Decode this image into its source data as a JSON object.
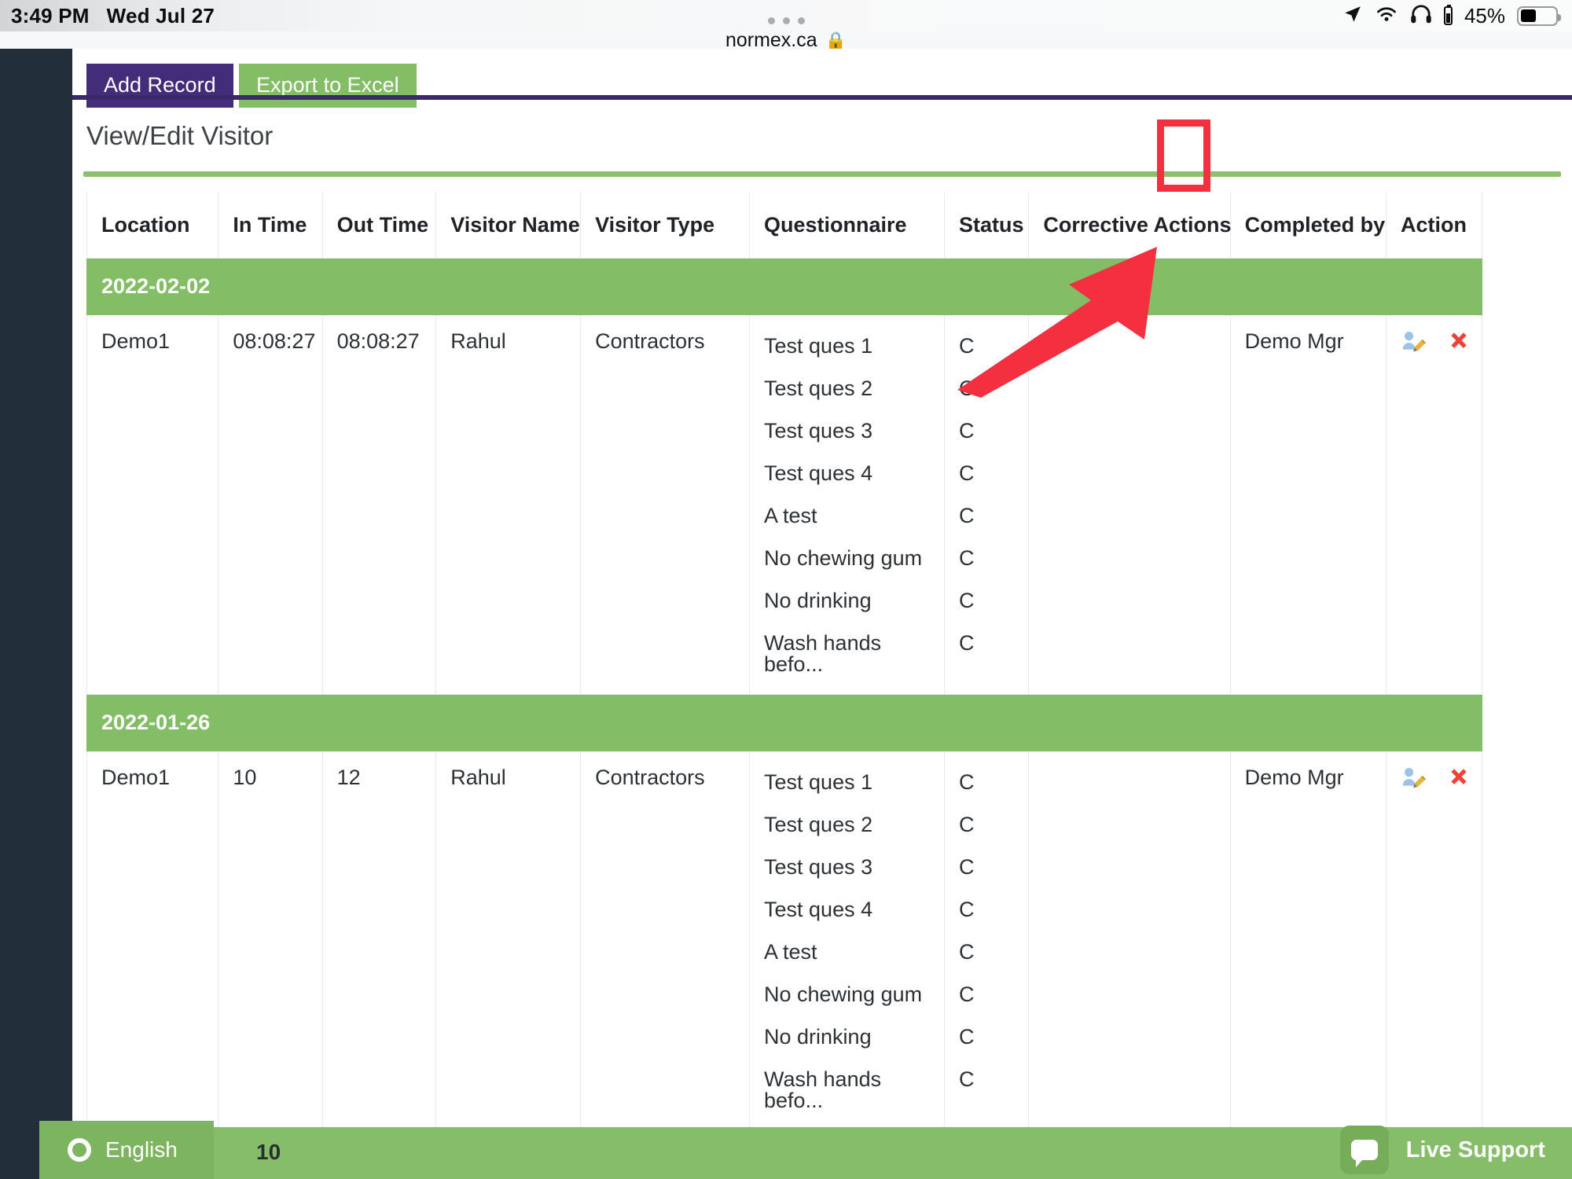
{
  "statusbar": {
    "time": "3:49 PM",
    "date": "Wed Jul 27",
    "battery_percent": "45%",
    "icons": [
      "location-arrow-icon",
      "wifi-icon",
      "headphones-icon",
      "headphone-battery-icon",
      "battery-icon"
    ]
  },
  "browser": {
    "url": "normex.ca",
    "lock": "🔒",
    "tab_dots": 3
  },
  "toolbar": {
    "add_record_label": "Add Record",
    "export_excel_label": "Export to Excel"
  },
  "page": {
    "title": "View/Edit Visitor"
  },
  "table": {
    "columns": [
      "Location",
      "In Time",
      "Out Time",
      "Visitor Name",
      "Visitor Type",
      "Questionnaire",
      "Status",
      "Corrective Actions",
      "Completed by",
      "Action"
    ],
    "groups": [
      {
        "date": "2022-02-02",
        "rows": [
          {
            "location": "Demo1",
            "in_time": "08:08:27",
            "out_time": "08:08:27",
            "visitor_name": "Rahul",
            "visitor_type": "Contractors",
            "questionnaire": [
              "Test ques 1",
              "Test ques 2",
              "Test ques 3",
              "Test ques 4",
              "A test",
              "No chewing gum",
              "No drinking",
              "Wash hands befo..."
            ],
            "status": [
              "C",
              "C",
              "C",
              "C",
              "C",
              "C",
              "C",
              "C"
            ],
            "corrective_actions": "",
            "completed_by": "Demo Mgr",
            "actions": [
              "edit-icon",
              "delete-icon"
            ]
          }
        ]
      },
      {
        "date": "2022-01-26",
        "rows": [
          {
            "location": "Demo1",
            "in_time": "10",
            "out_time": "12",
            "visitor_name": "Rahul",
            "visitor_type": "Contractors",
            "questionnaire": [
              "Test ques 1",
              "Test ques 2",
              "Test ques 3",
              "Test ques 4",
              "A test",
              "No chewing gum",
              "No drinking",
              "Wash hands befo..."
            ],
            "status": [
              "C",
              "C",
              "C",
              "C",
              "C",
              "C",
              "C",
              "C"
            ],
            "corrective_actions": "",
            "completed_by": "Demo Mgr",
            "actions": [
              "edit-icon",
              "delete-icon"
            ]
          }
        ]
      }
    ]
  },
  "bottom_bar": {
    "language_label": "English",
    "count_text": "10",
    "support_label": "Live Support"
  },
  "annotations": {
    "highlight_target": "Action",
    "arrow_target": "edit-icon",
    "color": "#f42f40"
  },
  "colors": {
    "purple": "#432d7a",
    "green": "#83bd66",
    "dark_rail": "#222f3a",
    "annotation_red": "#f42f40"
  }
}
